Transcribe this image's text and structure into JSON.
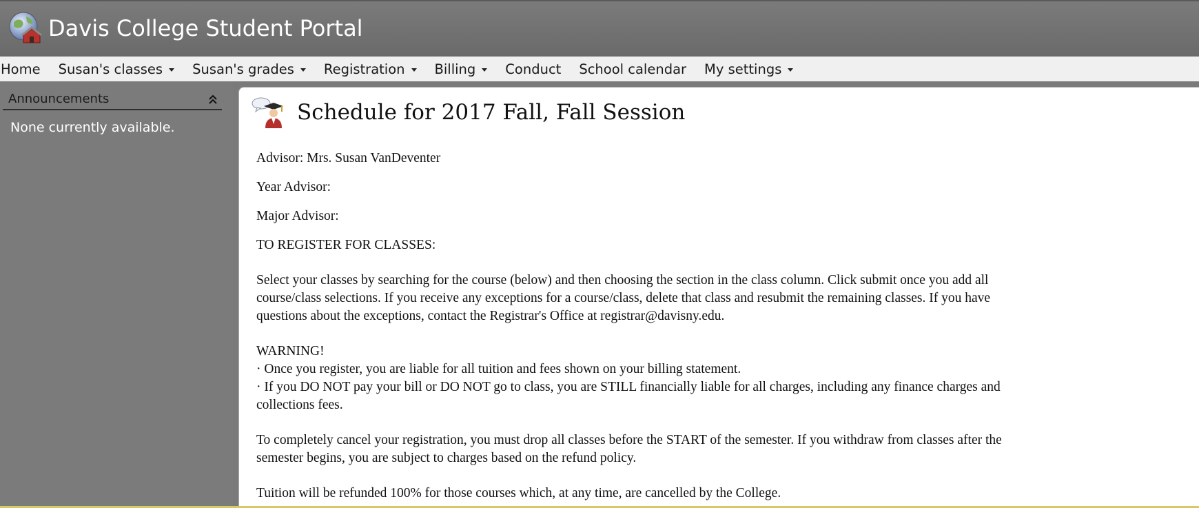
{
  "header": {
    "site_title": "Davis College Student Portal",
    "logo_icon": "globe-school-icon"
  },
  "nav": {
    "items": [
      {
        "label": "Home",
        "has_dropdown": false
      },
      {
        "label": "Susan's classes",
        "has_dropdown": true
      },
      {
        "label": "Susan's grades",
        "has_dropdown": true
      },
      {
        "label": "Registration",
        "has_dropdown": true
      },
      {
        "label": "Billing",
        "has_dropdown": true
      },
      {
        "label": "Conduct",
        "has_dropdown": false
      },
      {
        "label": "School calendar",
        "has_dropdown": false
      },
      {
        "label": "My settings",
        "has_dropdown": true
      }
    ]
  },
  "sidebar": {
    "panel_title": "Announcements",
    "collapse_icon": "double-chevron-up-icon",
    "empty_text": "None currently available."
  },
  "main": {
    "title": "Schedule for 2017 Fall, Fall Session",
    "title_icon": "graduate-speech-bubble-icon",
    "advisor": "Advisor: Mrs. Susan VanDeventer",
    "year_advisor": "Year Advisor:",
    "major_advisor": "Major Advisor:",
    "register_heading": "TO REGISTER FOR CLASSES:",
    "instructions": [
      "Select your classes by searching for the course (below) and then choosing the section in the class column. Click submit once you add all",
      "course/class selections. If you receive any exceptions for a course/class, delete that class and resubmit the remaining classes. If you have",
      "questions about the exceptions, contact the Registrar's Office at registrar@davisny.edu."
    ],
    "warning_heading": "WARNING!",
    "warning_lines": [
      "· Once you register, you are liable for all tuition and fees shown on your billing statement.",
      "· If you DO NOT pay your bill or DO NOT go to class, you are STILL financially liable for all charges, including any finance charges and",
      "collections fees."
    ],
    "cancel_lines": [
      "To completely cancel your registration, you must drop all classes before the START of the semester. If you withdraw from classes after the",
      "semester begins, you are subject to charges based on the refund policy."
    ],
    "refund_line": "Tuition will be refunded 100% for those courses which, at any time, are cancelled by the College."
  },
  "colors": {
    "header_bg": "#707070",
    "nav_bg": "#f0f0f0",
    "sidebar_bg": "#7b7b7b",
    "content_bg": "#ffffff",
    "bottom_accent": "#d7c868"
  }
}
